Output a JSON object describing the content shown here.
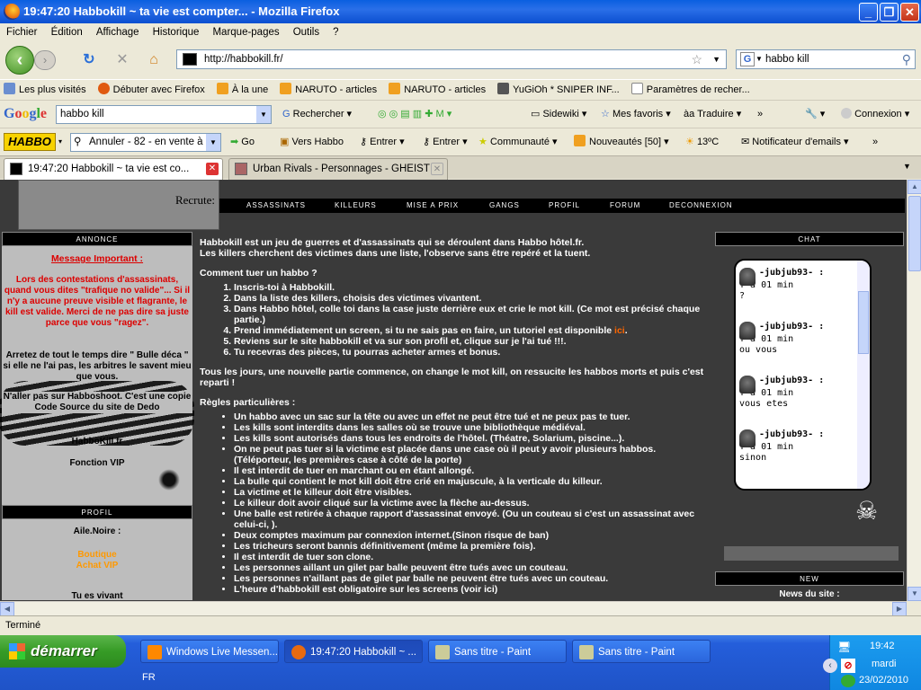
{
  "window": {
    "title": "19:47:20 Habbokill ~ ta vie est compter... - Mozilla Firefox"
  },
  "menu": [
    "Fichier",
    "Édition",
    "Affichage",
    "Historique",
    "Marque-pages",
    "Outils",
    "?"
  ],
  "nav": {
    "url": "http://habbokill.fr/",
    "search_value": "habbo kill"
  },
  "bookmarks": [
    "Les plus visités",
    "Débuter avec Firefox",
    "À la une",
    "NARUTO - articles",
    "NARUTO - articles",
    "YuGiOh * SNIPER INF...",
    "Paramètres de recher..."
  ],
  "google_toolbar": {
    "logo": "Google",
    "query": "habbo kill",
    "search_label": "Rechercher",
    "items": [
      "Sidewiki",
      "Mes favoris",
      "Traduire",
      "»",
      "Connexion"
    ]
  },
  "habbo_toolbar": {
    "logo": "HABBO",
    "search_value": "Annuler - 82 - en vente à",
    "go": "Go",
    "items": [
      "Vers Habbo",
      "Entrer",
      "Entrer",
      "Communauté",
      "Nouveautés [50]",
      "13ºC",
      "Notificateur d'emails",
      "»"
    ]
  },
  "tabs": [
    {
      "label": "19:47:20 Habbokill ~ ta vie est co...",
      "active": true
    },
    {
      "label": "Urban Rivals - Personnages - GHEIST",
      "active": false
    }
  ],
  "page": {
    "recrute": "Recrute:",
    "nav_links": [
      "ASSASSINATS",
      "KILLEURS",
      "MISE A PRIX",
      "GANGS",
      "PROFIL",
      "FORUM",
      "DECONNEXION"
    ],
    "left": {
      "annonce_header": "ANNONCE",
      "important_title": "Message Important :",
      "important_text": "Lors des contestations d'assassinats, quand vous dites \"trafique no valide\"... Si il n'y a aucune preuve visible et flagrante, le kill est valide. Merci de ne pas dire sa juste parce que vous \"ragez\".",
      "warning_text": "Arretez de tout le temps dire \" Bulle déca \" si elle ne l'ai pas, les arbitres le savent mieu que vous.",
      "habboshoot_text": "N'aller pas sur Habboshoot. C'est une copie Code Source du site de Dedo",
      "site_name": "HabboKill.fr",
      "vip": "Fonction VIP",
      "profil_header": "PROFIL",
      "user": "Aile.Noire :",
      "boutique": "Boutique",
      "achat_vip": "Achat VIP",
      "vivant": "Tu es vivant"
    },
    "main": {
      "intro1": "Habbokill est un jeu de guerres et d'assassinats qui se déroulent dans Habbo hôtel.fr.",
      "intro2": "Les killers cherchent des victimes dans une liste, l'observe sans être repéré et la tuent.",
      "howto_title": "Comment tuer un habbo ?",
      "steps": [
        "Inscris-toi à Habbokill.",
        "Dans la liste des killers, choisis des victimes vivantent.",
        "Dans Habbo hôtel, colle toi dans la case juste derrière eux et crie le mot kill. (Ce mot est précisé chaque partie.)",
        "Prend immédiatement un screen, si tu ne sais pas en faire, un tutoriel est disponible",
        "Reviens sur le site habbokill et va sur son profil et, clique sur je l'ai tué !!!.",
        "Tu recevras des pièces, tu pourras acheter armes et bonus."
      ],
      "ici": "ici",
      "daily": "Tous les jours, une nouvelle partie commence, on change le mot kill, on ressucite les habbos morts et puis c'est reparti !",
      "rules_title": "Règles particulières :",
      "rules": [
        "Un habbo avec un sac sur la tête ou avec un effet ne peut être tué et ne peux pas te tuer.",
        "Les kills sont interdits dans les salles où se trouve une bibliothèque médiéval.",
        "Les kills sont autorisés dans tous les endroits de l'hôtel. (Théatre, Solarium, piscine...).",
        "On ne peut pas tuer si la victime est placée dans une case où il peut y avoir plusieurs habbos. (Téléporteur, les premières case à côté de la porte)",
        "Il est interdit de tuer en marchant ou en étant allongé.",
        "La bulle qui contient le mot kill doit être crié en majuscule, à la verticale du killeur.",
        "La victime et le killeur doit être visibles.",
        "Le killeur doit avoir cliqué sur la victime avec la flèche au-dessus.",
        "Une balle est retirée à chaque rapport d'assassinat envoyé. (Ou un couteau si c'est un assassinat avec celui-ci, ).",
        "Deux comptes maximum par connexion internet.(Sinon risque de ban)",
        "Les tricheurs seront bannis définitivement (même la première fois).",
        "Il est interdit de tuer son clone.",
        "Les personnes aillant un gilet par balle peuvent être tués avec un couteau.",
        "Les personnes n'aillant pas de gilet par balle ne peuvent être tués avec un couteau.",
        "L'heure d'habbokill est obligatoire sur les screens (voir ici)"
      ]
    },
    "right": {
      "chat_header": "CHAT",
      "messages": [
        {
          "user": "-jubjub93- :",
          "time": "Y'a 01 min",
          "text": "?"
        },
        {
          "user": "-jubjub93- :",
          "time": "Y'a 01 min",
          "text": "ou vous"
        },
        {
          "user": "-jubjub93- :",
          "time": "Y'a 01 min",
          "text": "vous etes"
        },
        {
          "user": "-jubjub93- :",
          "time": "Y'a 01 min",
          "text": "sinon"
        }
      ],
      "new_header": "NEW",
      "news_title": "News du site :"
    }
  },
  "status": "Terminé",
  "taskbar": {
    "start": "démarrer",
    "tasks": [
      "Windows Live Messen...",
      "19:47:20 Habbokill ~ ...",
      "Sans titre - Paint",
      "Sans titre - Paint"
    ],
    "lang": "FR",
    "time": "19:42",
    "day": "mardi",
    "date": "23/02/2010"
  }
}
